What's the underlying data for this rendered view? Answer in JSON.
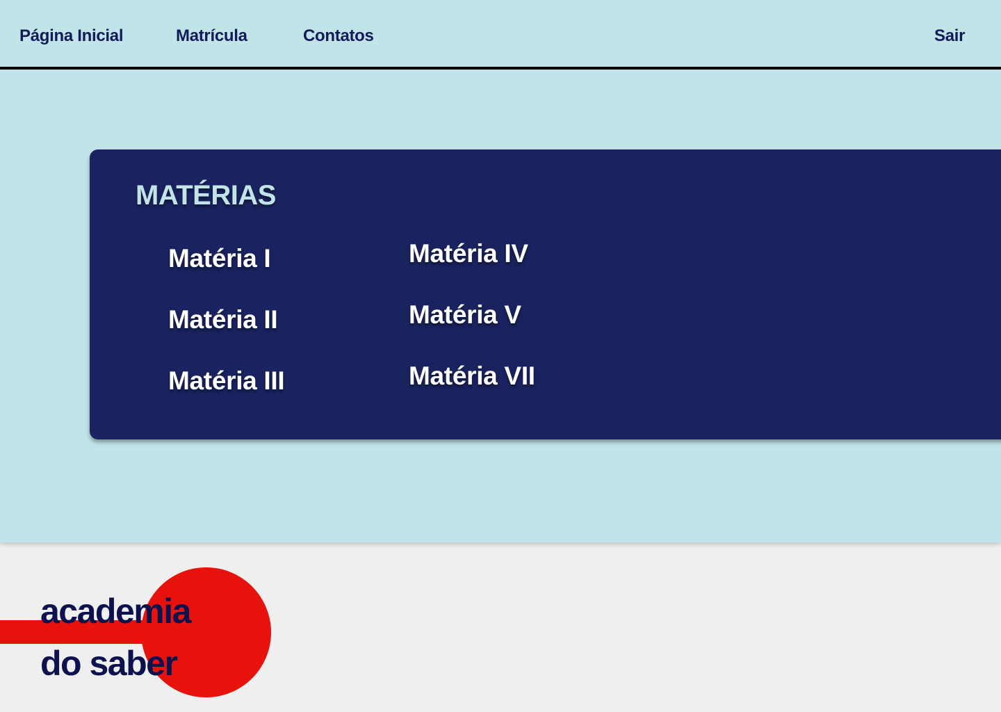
{
  "nav": {
    "items": [
      {
        "label": "Página Inicial"
      },
      {
        "label": "Matrícula"
      },
      {
        "label": "Contatos"
      }
    ],
    "logout_label": "Sair"
  },
  "subjects": {
    "title": "MATÉRIAS",
    "column1": [
      "Matéria I",
      "Matéria II",
      "Matéria III"
    ],
    "column2": [
      "Matéria IV",
      "Matéria V",
      "Matéria VII"
    ]
  },
  "footer": {
    "logo_line1": "academia",
    "logo_line2": "do saber"
  },
  "colors": {
    "header_bg": "#c1e4e8",
    "panel_bg": "#1a235f",
    "footer_bg": "#efefef",
    "nav_text": "#111b5a",
    "logo_red": "#e8120c",
    "logo_text": "#0d124f"
  }
}
